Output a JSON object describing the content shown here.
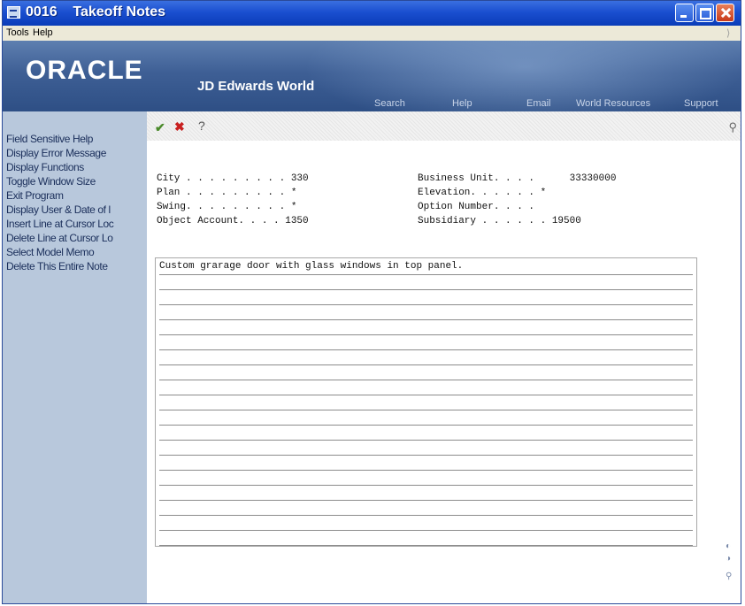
{
  "window": {
    "title": "0016    Takeoff Notes"
  },
  "menu": {
    "items": [
      "Tools",
      "Help"
    ]
  },
  "banner": {
    "brand": "ORACLE",
    "product": "JD Edwards World",
    "links": [
      "Search",
      "Help",
      "Email",
      "World Resources",
      "Support"
    ]
  },
  "sidebar": {
    "items": [
      "Field Sensitive Help",
      "Display Error Message",
      "Display Functions",
      "Toggle Window Size",
      "Exit Program",
      "Display User & Date of l",
      "Insert Line at Cursor Loc",
      "Delete Line at Cursor Lo",
      "Select Model Memo",
      "Delete This Entire Note"
    ]
  },
  "toolbar": {
    "ok_icon": "✔",
    "cancel_icon": "✖",
    "help_icon": "?",
    "search_icon": "🔍"
  },
  "fields": {
    "city": "City . . . . . . . . . 330",
    "plan": "Plan . . . . . . . . . *",
    "swing": "Swing. . . . . . . . . *",
    "object_account": "Object Account. . . . 1350",
    "business_unit": "Business Unit. . . .      33330000",
    "elevation": "Elevation. . . . . . *",
    "option_number": "Option Number. . . .",
    "subsidiary": "Subsidiary . . . . . . 19500"
  },
  "memo": {
    "lines": [
      "Custom grarage door with glass windows in top panel.",
      "",
      "",
      "",
      "",
      "",
      "",
      "",
      "",
      "",
      "",
      "",
      "",
      "",
      "",
      "",
      "",
      "",
      ""
    ]
  }
}
